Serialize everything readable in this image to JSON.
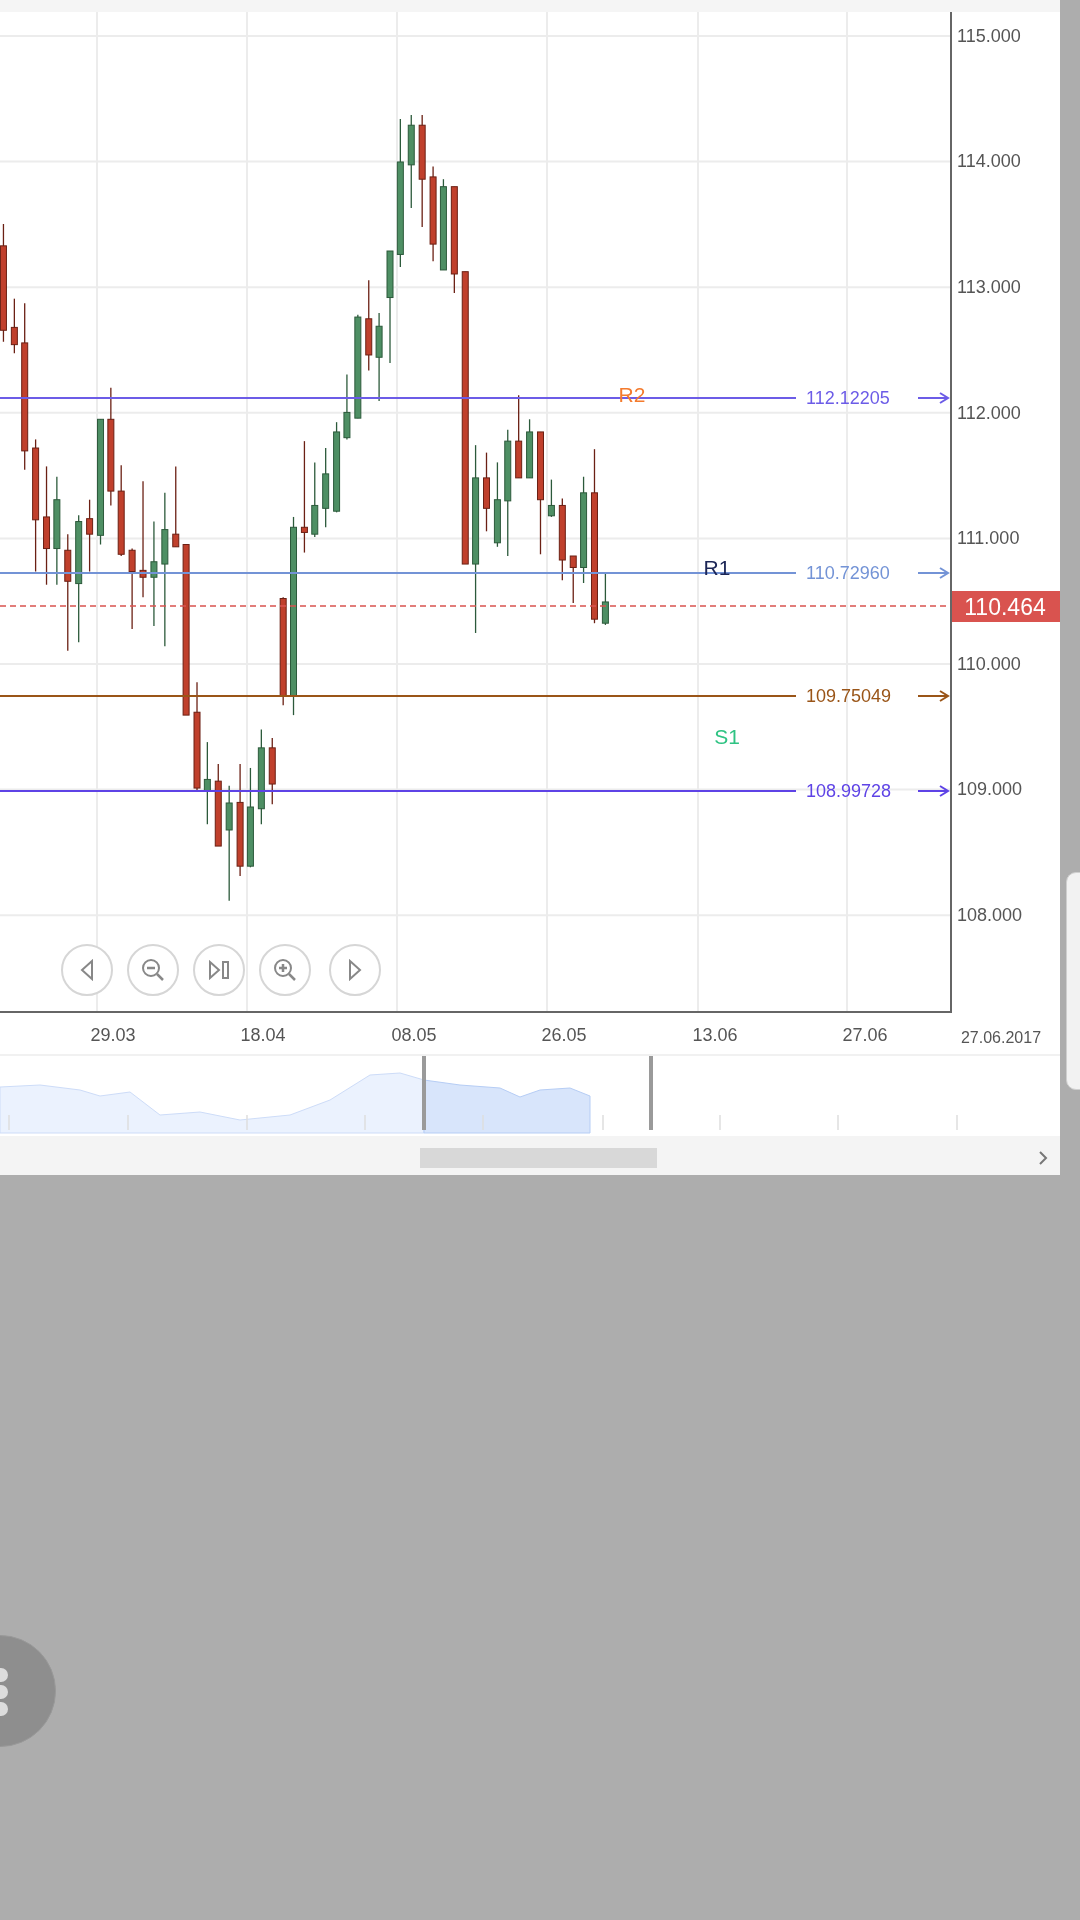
{
  "y_axis": [
    "115.000",
    "114.000",
    "113.000",
    "112.000",
    "111.000",
    "110.000",
    "109.000",
    "108.000"
  ],
  "levels": [
    {
      "price": "112.12205",
      "color": "#6c5ce7"
    },
    {
      "price": "110.72960",
      "color": "#7393d6"
    },
    {
      "price": "109.75049",
      "color": "#9a5518"
    },
    {
      "price": "108.99728",
      "color": "#5e43e6"
    }
  ],
  "markers": [
    {
      "label": "R2",
      "color": "#f47b2e"
    },
    {
      "label": "R1",
      "color": "#1c2656"
    },
    {
      "label": "S1",
      "color": "#2fc383"
    }
  ],
  "current_price": "110.464",
  "navigation_buttons": [
    {
      "kind": "previous"
    },
    {
      "kind": "zoom_out"
    },
    {
      "kind": "end"
    },
    {
      "kind": "zoom_in"
    },
    {
      "kind": "next"
    }
  ],
  "x_axis": [
    "29.03",
    "18.04",
    "08.05",
    "26.05",
    "13.06",
    "27.06"
  ],
  "end_date": "27.06.2017"
}
